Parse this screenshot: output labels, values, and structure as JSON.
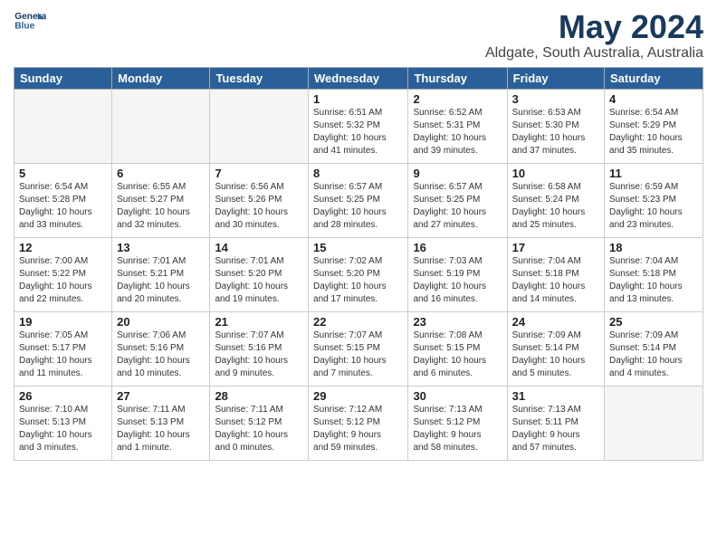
{
  "header": {
    "logo_line1": "General",
    "logo_line2": "Blue",
    "month": "May 2024",
    "location": "Aldgate, South Australia, Australia"
  },
  "weekdays": [
    "Sunday",
    "Monday",
    "Tuesday",
    "Wednesday",
    "Thursday",
    "Friday",
    "Saturday"
  ],
  "weeks": [
    [
      {
        "day": "",
        "info": ""
      },
      {
        "day": "",
        "info": ""
      },
      {
        "day": "",
        "info": ""
      },
      {
        "day": "1",
        "info": "Sunrise: 6:51 AM\nSunset: 5:32 PM\nDaylight: 10 hours\nand 41 minutes."
      },
      {
        "day": "2",
        "info": "Sunrise: 6:52 AM\nSunset: 5:31 PM\nDaylight: 10 hours\nand 39 minutes."
      },
      {
        "day": "3",
        "info": "Sunrise: 6:53 AM\nSunset: 5:30 PM\nDaylight: 10 hours\nand 37 minutes."
      },
      {
        "day": "4",
        "info": "Sunrise: 6:54 AM\nSunset: 5:29 PM\nDaylight: 10 hours\nand 35 minutes."
      }
    ],
    [
      {
        "day": "5",
        "info": "Sunrise: 6:54 AM\nSunset: 5:28 PM\nDaylight: 10 hours\nand 33 minutes."
      },
      {
        "day": "6",
        "info": "Sunrise: 6:55 AM\nSunset: 5:27 PM\nDaylight: 10 hours\nand 32 minutes."
      },
      {
        "day": "7",
        "info": "Sunrise: 6:56 AM\nSunset: 5:26 PM\nDaylight: 10 hours\nand 30 minutes."
      },
      {
        "day": "8",
        "info": "Sunrise: 6:57 AM\nSunset: 5:25 PM\nDaylight: 10 hours\nand 28 minutes."
      },
      {
        "day": "9",
        "info": "Sunrise: 6:57 AM\nSunset: 5:25 PM\nDaylight: 10 hours\nand 27 minutes."
      },
      {
        "day": "10",
        "info": "Sunrise: 6:58 AM\nSunset: 5:24 PM\nDaylight: 10 hours\nand 25 minutes."
      },
      {
        "day": "11",
        "info": "Sunrise: 6:59 AM\nSunset: 5:23 PM\nDaylight: 10 hours\nand 23 minutes."
      }
    ],
    [
      {
        "day": "12",
        "info": "Sunrise: 7:00 AM\nSunset: 5:22 PM\nDaylight: 10 hours\nand 22 minutes."
      },
      {
        "day": "13",
        "info": "Sunrise: 7:01 AM\nSunset: 5:21 PM\nDaylight: 10 hours\nand 20 minutes."
      },
      {
        "day": "14",
        "info": "Sunrise: 7:01 AM\nSunset: 5:20 PM\nDaylight: 10 hours\nand 19 minutes."
      },
      {
        "day": "15",
        "info": "Sunrise: 7:02 AM\nSunset: 5:20 PM\nDaylight: 10 hours\nand 17 minutes."
      },
      {
        "day": "16",
        "info": "Sunrise: 7:03 AM\nSunset: 5:19 PM\nDaylight: 10 hours\nand 16 minutes."
      },
      {
        "day": "17",
        "info": "Sunrise: 7:04 AM\nSunset: 5:18 PM\nDaylight: 10 hours\nand 14 minutes."
      },
      {
        "day": "18",
        "info": "Sunrise: 7:04 AM\nSunset: 5:18 PM\nDaylight: 10 hours\nand 13 minutes."
      }
    ],
    [
      {
        "day": "19",
        "info": "Sunrise: 7:05 AM\nSunset: 5:17 PM\nDaylight: 10 hours\nand 11 minutes."
      },
      {
        "day": "20",
        "info": "Sunrise: 7:06 AM\nSunset: 5:16 PM\nDaylight: 10 hours\nand 10 minutes."
      },
      {
        "day": "21",
        "info": "Sunrise: 7:07 AM\nSunset: 5:16 PM\nDaylight: 10 hours\nand 9 minutes."
      },
      {
        "day": "22",
        "info": "Sunrise: 7:07 AM\nSunset: 5:15 PM\nDaylight: 10 hours\nand 7 minutes."
      },
      {
        "day": "23",
        "info": "Sunrise: 7:08 AM\nSunset: 5:15 PM\nDaylight: 10 hours\nand 6 minutes."
      },
      {
        "day": "24",
        "info": "Sunrise: 7:09 AM\nSunset: 5:14 PM\nDaylight: 10 hours\nand 5 minutes."
      },
      {
        "day": "25",
        "info": "Sunrise: 7:09 AM\nSunset: 5:14 PM\nDaylight: 10 hours\nand 4 minutes."
      }
    ],
    [
      {
        "day": "26",
        "info": "Sunrise: 7:10 AM\nSunset: 5:13 PM\nDaylight: 10 hours\nand 3 minutes."
      },
      {
        "day": "27",
        "info": "Sunrise: 7:11 AM\nSunset: 5:13 PM\nDaylight: 10 hours\nand 1 minute."
      },
      {
        "day": "28",
        "info": "Sunrise: 7:11 AM\nSunset: 5:12 PM\nDaylight: 10 hours\nand 0 minutes."
      },
      {
        "day": "29",
        "info": "Sunrise: 7:12 AM\nSunset: 5:12 PM\nDaylight: 9 hours\nand 59 minutes."
      },
      {
        "day": "30",
        "info": "Sunrise: 7:13 AM\nSunset: 5:12 PM\nDaylight: 9 hours\nand 58 minutes."
      },
      {
        "day": "31",
        "info": "Sunrise: 7:13 AM\nSunset: 5:11 PM\nDaylight: 9 hours\nand 57 minutes."
      },
      {
        "day": "",
        "info": ""
      }
    ]
  ]
}
